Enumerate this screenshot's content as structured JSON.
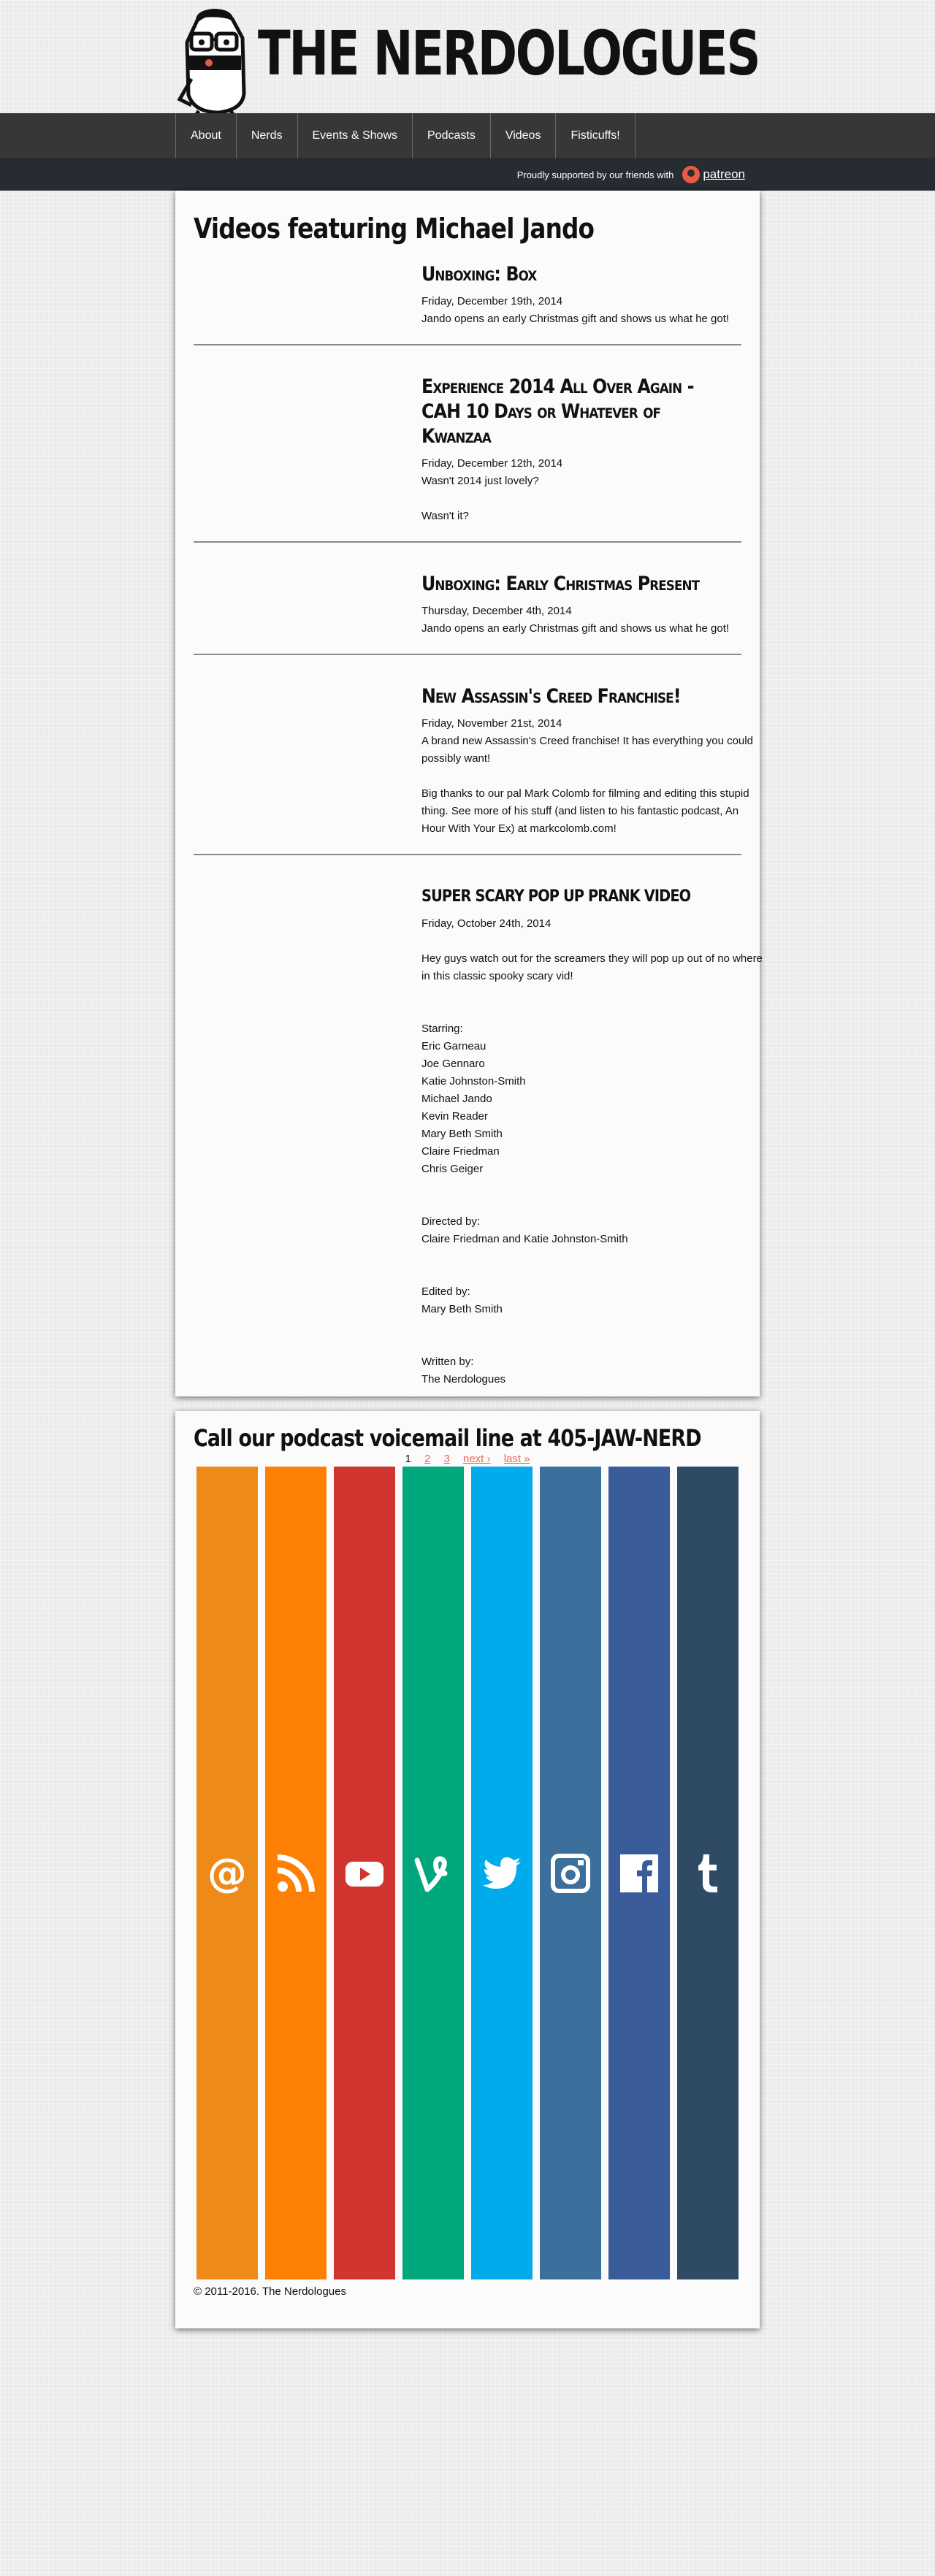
{
  "site": {
    "title": "THE NERDOLOGUES"
  },
  "nav": {
    "items": [
      "About",
      "Nerds",
      "Events & Shows",
      "Podcasts",
      "Videos",
      "Fisticuffs!"
    ]
  },
  "patreon": {
    "text": "Proudly supported by our friends with",
    "brand": "patreon",
    "color": "#e85b46"
  },
  "main": {
    "title": "Videos featuring Michael Jando",
    "videos": [
      {
        "title": "Unboxing: Box",
        "date": "Friday, December 19th, 2014",
        "desc": [
          "Jando opens an early Christmas gift and shows us what he got!"
        ]
      },
      {
        "title": "Experience 2014 All Over Again - CAH 10 Days or Whatever of Kwanzaa",
        "date": "Friday, December 12th, 2014",
        "desc": [
          "Wasn't 2014 just lovely?",
          "Wasn't it?"
        ]
      },
      {
        "title": "Unboxing: Early Christmas Present",
        "date": "Thursday, December 4th, 2014",
        "desc": [
          "Jando opens an early Christmas gift and shows us what he got!"
        ]
      },
      {
        "title": "New Assassin's Creed Franchise!",
        "date": "Friday, November 21st, 2014",
        "desc": [
          "A brand new Assassin's Creed franchise! It has everything you could possibly want!",
          "Big thanks to our pal Mark Colomb for filming and editing this stupid thing. See more of his stuff (and listen to his fantastic podcast, An Hour With Your Ex) at markcolomb.com!"
        ]
      },
      {
        "title": "SUPER SCARY POP UP PRANK VIDEO",
        "date": "Friday, October 24th, 2014",
        "desc": [
          "Hey guys watch out for the screamers they will pop up out of no where in this classic spooky scary vid!",
          "Starring:\nEric Garneau\nJoe Gennaro\nKatie Johnston-Smith\nMichael Jando\nKevin Reader\nMary Beth Smith\nClaire Friedman\nChris Geiger",
          "Directed by:\nClaire Friedman and Katie Johnston-Smith",
          "Edited by:\nMary Beth Smith",
          "Written by:\nThe Nerdologues"
        ]
      }
    ],
    "pager": {
      "current": "1",
      "pages": [
        "2",
        "3"
      ],
      "next": "next ›",
      "last": "last »"
    }
  },
  "footer": {
    "title": "Call our podcast voicemail line at 405-JAW-NERD",
    "social": [
      {
        "icon": "email-icon",
        "color": "#ee8a17"
      },
      {
        "icon": "rss-icon",
        "color": "#fd7f03"
      },
      {
        "icon": "youtube-icon",
        "color": "#d13530"
      },
      {
        "icon": "vine-icon",
        "color": "#00a67c"
      },
      {
        "icon": "twitter-icon",
        "color": "#00abec"
      },
      {
        "icon": "instagram-icon",
        "color": "#3c6f9c"
      },
      {
        "icon": "facebook-icon",
        "color": "#3b5c9b"
      },
      {
        "icon": "tumblr-icon",
        "color": "#2e4a65"
      }
    ],
    "copyright": "© 2011-2016. The Nerdologues"
  }
}
